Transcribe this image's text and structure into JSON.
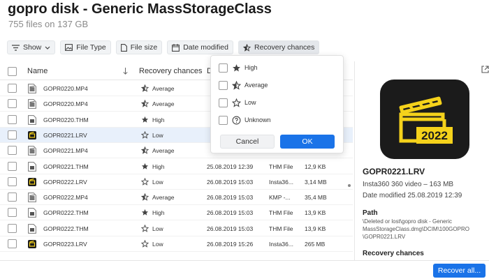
{
  "title": "gopro disk - Generic MassStorageClass",
  "subtitle": "755 files on 137 GB",
  "toolbar": {
    "show": "Show",
    "file_type": "File Type",
    "file_size": "File size",
    "date_modified": "Date modified",
    "recovery_chances": "Recovery chances"
  },
  "columns": {
    "name": "Name",
    "recovery": "Recovery chances",
    "date": "D"
  },
  "rows": [
    {
      "name": "GOPR0220.MP4",
      "type": "mp4",
      "chance": "Average",
      "date": "",
      "kind": "",
      "size": ""
    },
    {
      "name": "GOPR0220.MP4",
      "type": "mp4",
      "chance": "Average",
      "date": "",
      "kind": "",
      "size": ""
    },
    {
      "name": "GOPR0220.THM",
      "type": "thm",
      "chance": "High",
      "date": "",
      "kind": "",
      "size": ""
    },
    {
      "name": "GOPR0221.LRV",
      "type": "lrv",
      "chance": "Low",
      "date": "",
      "kind": "",
      "size": ""
    },
    {
      "name": "GOPR0221.MP4",
      "type": "mp4",
      "chance": "Average",
      "date": "",
      "kind": "",
      "size": ""
    },
    {
      "name": "GOPR0221.THM",
      "type": "thm",
      "chance": "High",
      "date": "25.08.2019 12:39",
      "kind": "THM File",
      "size": "12,9 KB"
    },
    {
      "name": "GOPR0222.LRV",
      "type": "lrv",
      "chance": "Low",
      "date": "26.08.2019 15:03",
      "kind": "Insta36...",
      "size": "3,14 MB"
    },
    {
      "name": "GOPR0222.MP4",
      "type": "mp4",
      "chance": "Average",
      "date": "26.08.2019 15:03",
      "kind": "KMP -...",
      "size": "35,4 MB"
    },
    {
      "name": "GOPR0222.THM",
      "type": "thm",
      "chance": "High",
      "date": "26.08.2019 15:03",
      "kind": "THM File",
      "size": "13,9 KB"
    },
    {
      "name": "GOPR0222.THM",
      "type": "thm",
      "chance": "Low",
      "date": "26.08.2019 15:03",
      "kind": "THM File",
      "size": "13,9 KB"
    },
    {
      "name": "GOPR0223.LRV",
      "type": "lrv",
      "chance": "Low",
      "date": "26.08.2019 15:26",
      "kind": "Insta36...",
      "size": "265 MB"
    }
  ],
  "dropdown": {
    "options": [
      "High",
      "Average",
      "Low",
      "Unknown"
    ],
    "cancel": "Cancel",
    "ok": "OK"
  },
  "details": {
    "icon_year": "2022",
    "filename": "GOPR0221.LRV",
    "info": "Insta360 360 video – 163 MB",
    "date": "Date modified 25.08.2019 12:39",
    "path_heading": "Path",
    "path": "\\Deleted or lost\\gopro disk - Generic MassStorageClass.dmg\\DCIM\\100GOPRO \\GOPR0221.LRV",
    "recovery_heading": "Recovery chances"
  },
  "recover_all": "Recover all...",
  "colors": {
    "accent": "#1a73e8",
    "selected_row": "#e8f0fb",
    "icon_dark": "#1b1b1b",
    "icon_yellow": "#f5d21b"
  }
}
